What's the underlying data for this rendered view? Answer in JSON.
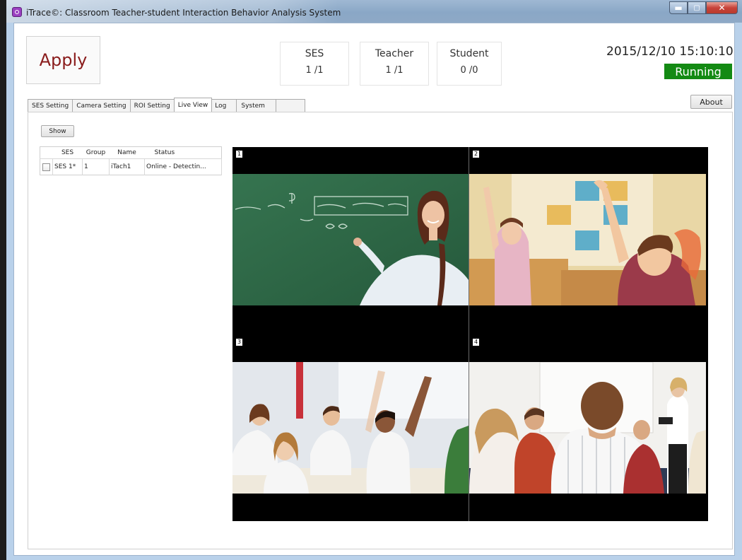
{
  "window": {
    "title": "iTrace©: Classroom Teacher-student Interaction Behavior Analysis System"
  },
  "header": {
    "apply_label": "Apply",
    "stats": [
      {
        "label": "SES",
        "value": "1  /1"
      },
      {
        "label": "Teacher",
        "value": "1  /1"
      },
      {
        "label": "Student",
        "value": "0  /0"
      }
    ],
    "datetime": "2015/12/10 15:10:10",
    "status": "Running",
    "status_color": "#138a13",
    "about_label": "About"
  },
  "tabs": [
    {
      "label": "SES Setting",
      "active": false
    },
    {
      "label": "Camera Setting",
      "active": false
    },
    {
      "label": "ROI Setting",
      "active": false
    },
    {
      "label": "Live View",
      "active": true
    },
    {
      "label": "Log",
      "active": false
    },
    {
      "label": "System",
      "active": false
    }
  ],
  "live_view": {
    "show_label": "Show",
    "columns": [
      "SES",
      "Group",
      "Name",
      "Status"
    ],
    "rows": [
      {
        "ses": "SES 1*",
        "group": "1",
        "name": "iTach1",
        "status": "Online - Detectin..."
      }
    ],
    "camera_cells": [
      "1",
      "2",
      "3",
      "4"
    ]
  }
}
